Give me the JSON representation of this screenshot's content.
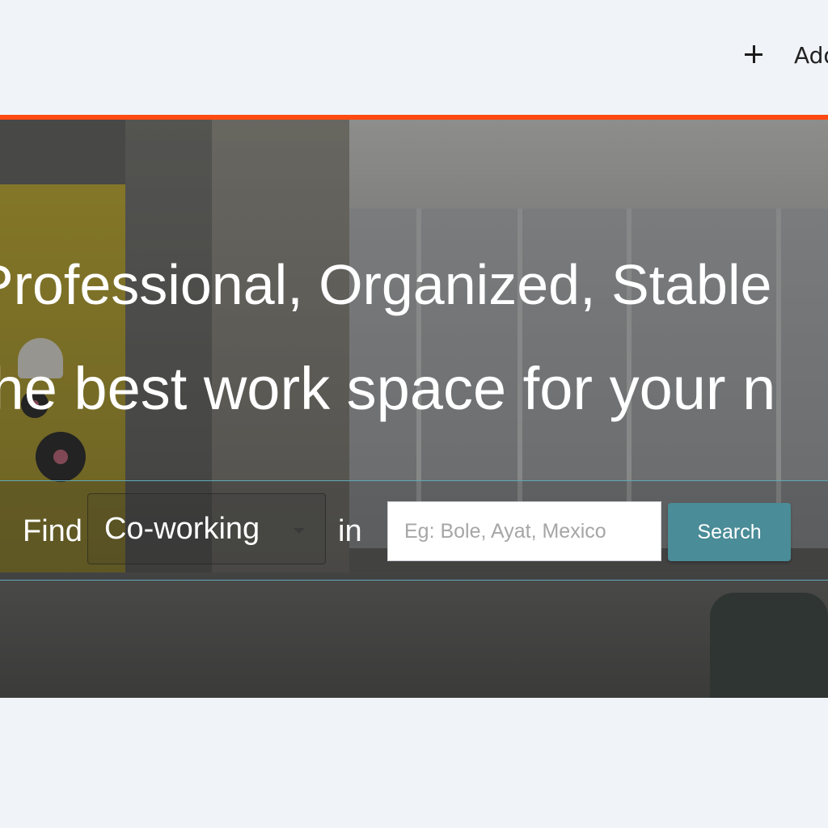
{
  "header": {
    "add_icon": "plus-icon",
    "add_label": "Add"
  },
  "colors": {
    "accent": "#ff4a12",
    "button": "#4a8c97",
    "page_background": "#f0f3f8"
  },
  "hero": {
    "headline": "Professional, Organized, Stable",
    "subline": "the best work space for your n",
    "search": {
      "find_label": "Find",
      "type_selected": "Co-working",
      "in_label": "in",
      "location_placeholder": "Eg: Bole, Ayat, Mexico",
      "location_value": "",
      "button_label": "Search"
    }
  }
}
